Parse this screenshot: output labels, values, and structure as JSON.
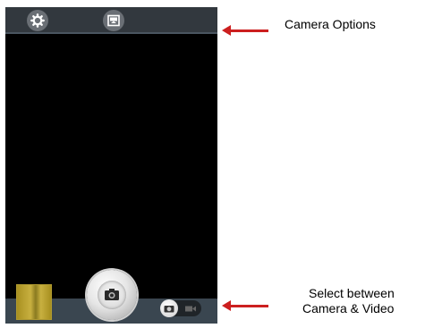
{
  "annotations": {
    "camera_options": "Camera Options",
    "select_mode_line1": "Select between",
    "select_mode_line2": "Camera & Video"
  },
  "icons": {
    "settings": "gear-icon",
    "scene": "image-frame-icon",
    "shutter": "camera-icon",
    "mode_camera": "camera-icon",
    "mode_video": "video-icon"
  },
  "colors": {
    "arrow": "#cc1f1f",
    "viewfinder": "#000000",
    "bar": "#32383e"
  }
}
